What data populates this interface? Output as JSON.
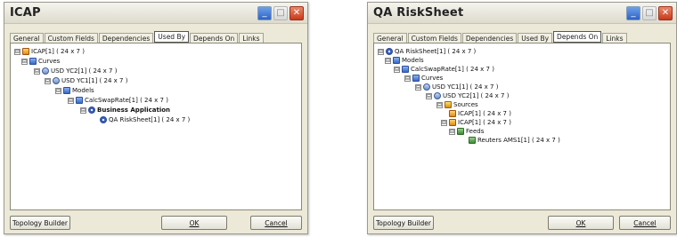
{
  "left": {
    "title": "ICAP",
    "tabs": [
      "General",
      "Custom Fields",
      "Dependencies",
      "Used By",
      "Depends On",
      "Links"
    ],
    "active_tab": "Used By",
    "tree": [
      {
        "label": "ICAP[1] ( 24 x 7 )",
        "icon": "tool-icon",
        "expander": "⊟"
      },
      {
        "label": "Curves",
        "icon": "folder-icon",
        "expander": "⊟"
      },
      {
        "label": "USD YC2[1] ( 24 x 7 )",
        "icon": "curve-icon",
        "expander": "⊟"
      },
      {
        "label": "USD YC1[1] ( 24 x 7 )",
        "icon": "curve-icon",
        "expander": "⊟"
      },
      {
        "label": "Models",
        "icon": "model-icon",
        "expander": "⊟"
      },
      {
        "label": "CalcSwapRate[1] ( 24 x 7 )",
        "icon": "model-icon",
        "expander": "⊟"
      },
      {
        "label": "Business Application",
        "icon": "app-icon",
        "expander": "⊟"
      },
      {
        "label": "QA RiskSheet[1] ( 24 x 7 )",
        "icon": "app-icon",
        "expander": ""
      }
    ],
    "buttons": {
      "topology": "Topology Builder",
      "ok": "OK",
      "cancel": "Cancel"
    }
  },
  "right": {
    "title": "QA RiskSheet",
    "tabs": [
      "General",
      "Custom Fields",
      "Dependencies",
      "Used By",
      "Depends On",
      "Links"
    ],
    "active_tab": "Depends On",
    "tree": [
      {
        "label": "QA RiskSheet[1] ( 24 x 7 )",
        "icon": "app-icon",
        "expander": "⊟"
      },
      {
        "label": "Models",
        "icon": "model-icon",
        "expander": "⊟"
      },
      {
        "label": "CalcSwapRate[1] ( 24 x 7 )",
        "icon": "model-icon",
        "expander": "⊟"
      },
      {
        "label": "Curves",
        "icon": "folder-icon",
        "expander": "⊟"
      },
      {
        "label": "USD YC1[1] ( 24 x 7 )",
        "icon": "curve-icon",
        "expander": "⊟"
      },
      {
        "label": "USD YC2[1] ( 24 x 7 )",
        "icon": "curve-icon",
        "expander": "⊟"
      },
      {
        "label": "Sources",
        "icon": "source-icon",
        "expander": "⊟"
      },
      {
        "label": "ICAP[1] ( 24 x 7 )",
        "icon": "tool-icon",
        "expander": ""
      },
      {
        "label": "ICAP[1] ( 24 x 7 )",
        "icon": "tool-icon",
        "expander": "⊟"
      },
      {
        "label": "Feeds",
        "icon": "feed-icon",
        "expander": "⊟"
      },
      {
        "label": "Reuters AMS1[1] ( 24 x 7 )",
        "icon": "feed-icon",
        "expander": ""
      }
    ],
    "buttons": {
      "topology": "Topology Builder",
      "ok": "OK",
      "cancel": "Cancel"
    }
  }
}
